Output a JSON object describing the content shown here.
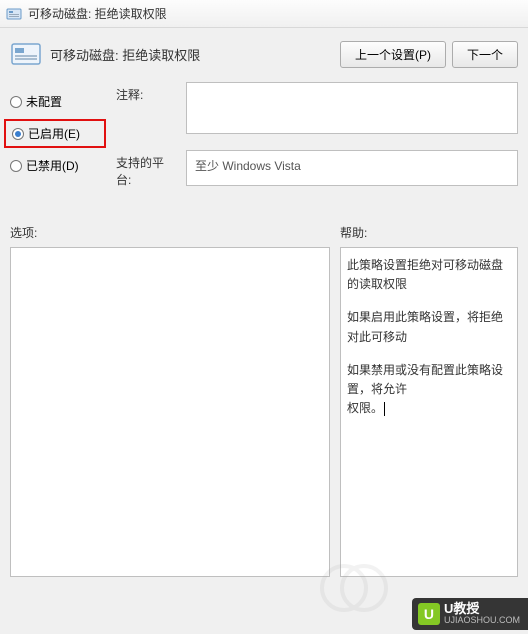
{
  "titlebar": {
    "title": "可移动磁盘: 拒绝读取权限"
  },
  "header": {
    "title": "可移动磁盘: 拒绝读取权限",
    "prev_button": "上一个设置(P)",
    "next_button": "下一个"
  },
  "radios": {
    "not_configured": "未配置",
    "enabled": "已启用(E)",
    "disabled": "已禁用(D)",
    "selected": "enabled"
  },
  "fields": {
    "comment_label": "注释:",
    "platform_label": "支持的平台:",
    "platform_value": "至少 Windows Vista"
  },
  "sections": {
    "options_label": "选项:",
    "help_label": "帮助:"
  },
  "help": {
    "p1": "此策略设置拒绝对可移动磁盘的读取权限",
    "p2": "如果启用此策略设置，将拒绝对此可移动",
    "p3_a": "如果禁用或没有配置此策略设置，将允许",
    "p3_b": "权限。"
  },
  "watermark": {
    "brand": "U教授",
    "url": "UJIAOSHOU.COM",
    "glyph": "U"
  }
}
